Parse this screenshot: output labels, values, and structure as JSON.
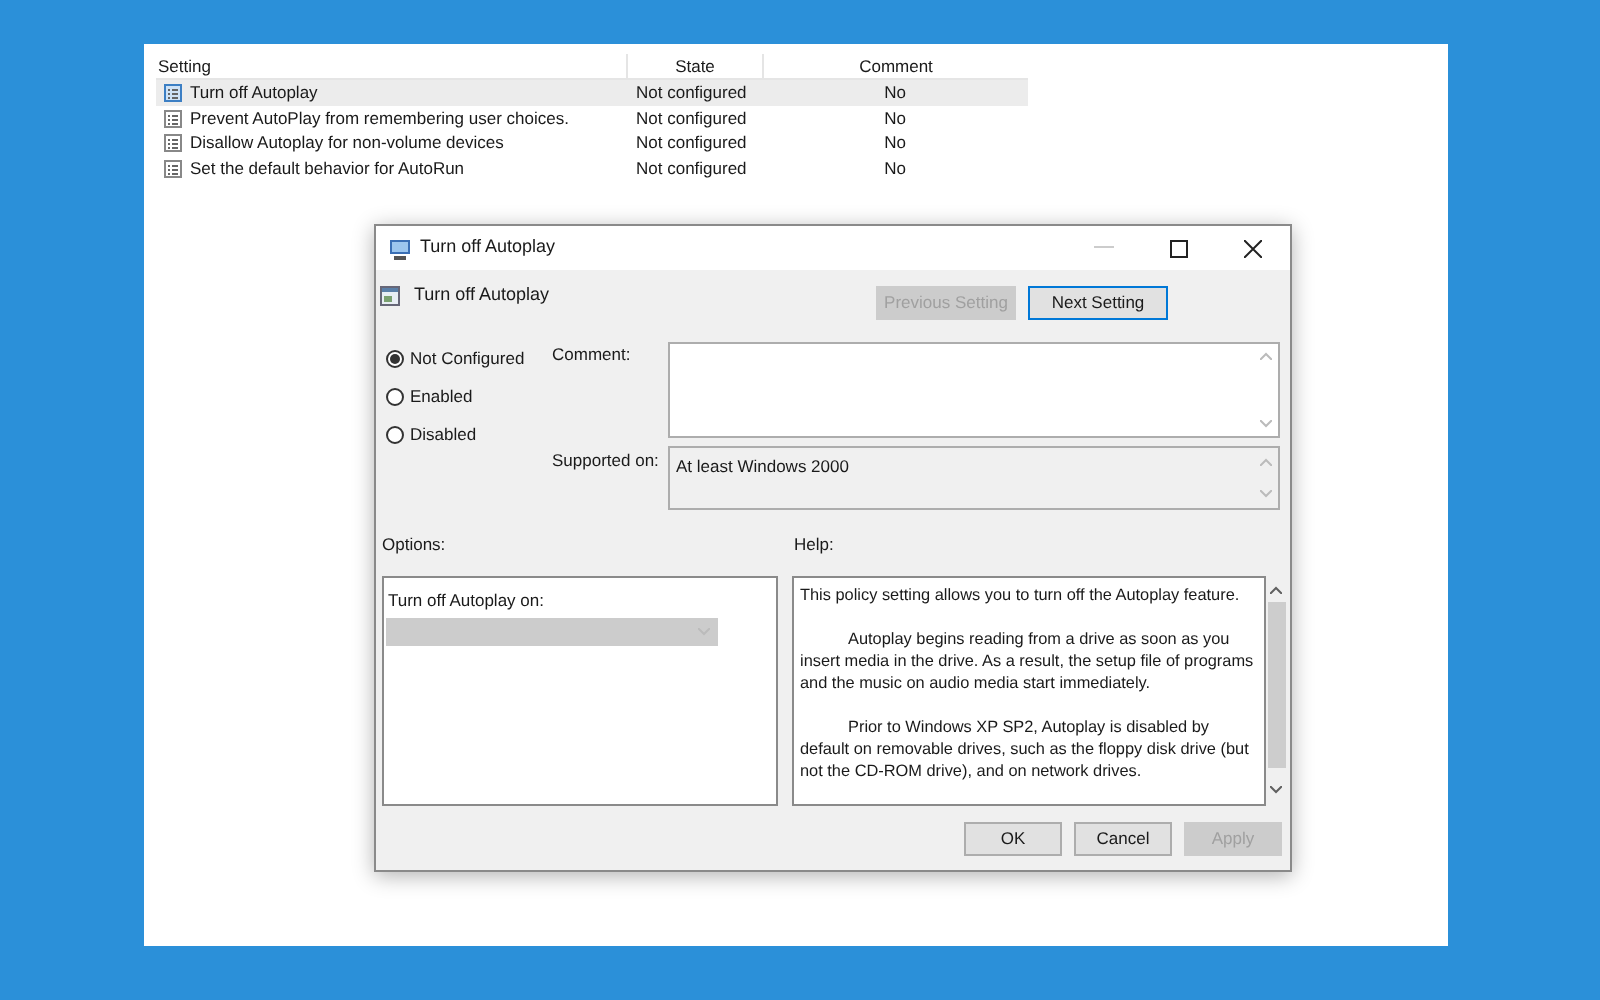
{
  "table": {
    "columns": [
      "Setting",
      "State",
      "Comment"
    ],
    "rows": [
      {
        "setting": "Turn off Autoplay",
        "state": "Not configured",
        "comment": "No",
        "selected": true
      },
      {
        "setting": "Prevent AutoPlay from remembering user choices.",
        "state": "Not configured",
        "comment": "No",
        "selected": false
      },
      {
        "setting": "Disallow Autoplay for non-volume devices",
        "state": "Not configured",
        "comment": "No",
        "selected": false
      },
      {
        "setting": "Set the default behavior for AutoRun",
        "state": "Not configured",
        "comment": "No",
        "selected": false
      }
    ]
  },
  "dialog": {
    "title": "Turn off Autoplay",
    "policy_name": "Turn off Autoplay",
    "nav_buttons": [
      {
        "label": "Previous Setting",
        "disabled": true,
        "focused": false
      },
      {
        "label": "Next Setting",
        "disabled": false,
        "focused": true
      }
    ],
    "radios": [
      {
        "label": "Not Configured",
        "selected": true
      },
      {
        "label": "Enabled",
        "selected": false
      },
      {
        "label": "Disabled",
        "selected": false
      }
    ],
    "comment_label": "Comment:",
    "supported_label": "Supported on:",
    "supported_value": "At least Windows 2000",
    "options_label": "Options:",
    "help_label": "Help:",
    "option": {
      "label": "Turn off Autoplay on:",
      "disabled": true
    },
    "help_paragraphs": [
      "This policy setting allows you to turn off the Autoplay feature.",
      "Autoplay begins reading from a drive as soon as you insert media in the drive. As a result, the setup file of programs and the music on audio media start immediately.",
      "Prior to Windows XP SP2, Autoplay is disabled by default on removable drives, such as the floppy disk drive (but not the CD-ROM drive), and on network drives."
    ],
    "buttons": [
      {
        "label": "OK",
        "disabled": false
      },
      {
        "label": "Cancel",
        "disabled": false
      },
      {
        "label": "Apply",
        "disabled": true
      }
    ]
  }
}
